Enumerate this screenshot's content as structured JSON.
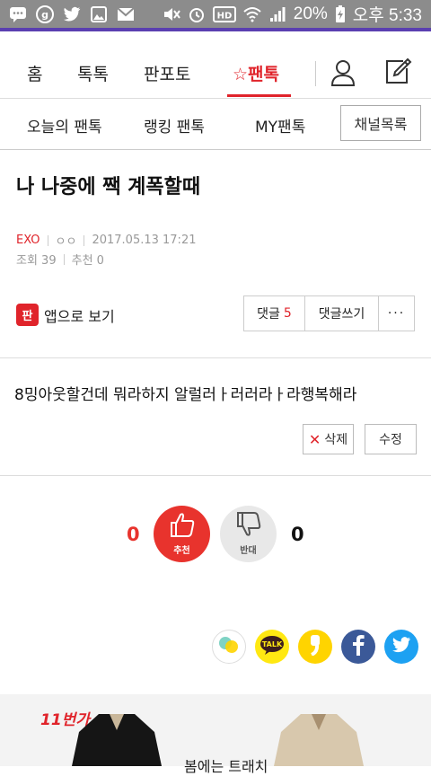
{
  "status_bar": {
    "battery": "20%",
    "time": "오후 5:33"
  },
  "nav": {
    "tabs": [
      {
        "label": "홈"
      },
      {
        "label": "톡톡"
      },
      {
        "label": "판포토"
      },
      {
        "label": "☆팬톡",
        "active": true
      }
    ]
  },
  "subnav": {
    "tabs": [
      "오늘의 팬톡",
      "랭킹 팬톡",
      "MY팬톡"
    ],
    "channel_button": "채널목록"
  },
  "post": {
    "title": "나 나중에 짹 계폭할때",
    "author": "EXO",
    "nickname": "ㅇㅇ",
    "datetime": "2017.05.13 17:21",
    "views_label": "조회 39",
    "recommend_label": "추천 0",
    "body": "8밍아웃할건데 뭐라하지 알럴러ㅏ러러라ㅏ라행복해라"
  },
  "actions": {
    "app_view": "앱으로 보기",
    "app_badge": "판",
    "comments_label": "댓글",
    "comments_count": "5",
    "write_comment": "댓글쓰기",
    "more": "···",
    "delete": "삭제",
    "edit": "수정"
  },
  "votes": {
    "up_count": "0",
    "up_label": "추천",
    "down_count": "0",
    "down_label": "반대"
  },
  "share": {
    "kakao_talk": "TALK"
  },
  "ad": {
    "logo": "11번가",
    "text": "봄에는 트래치"
  },
  "colors": {
    "accent": "#e0242b",
    "statusbar": "#8c8c8c",
    "purple": "#5a3fb0",
    "facebook": "#3b5998",
    "twitter": "#1da1f2",
    "kakao": "#ffe812"
  }
}
